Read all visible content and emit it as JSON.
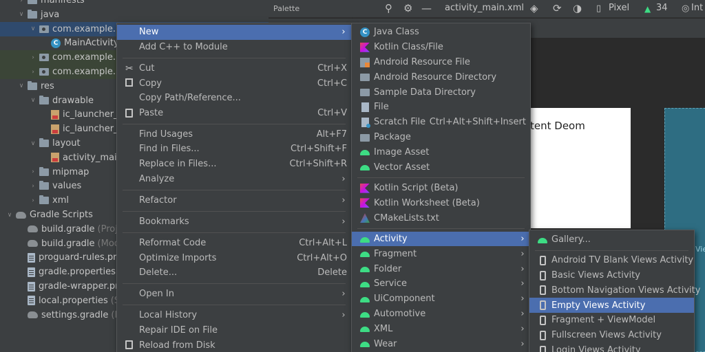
{
  "tree": {
    "rows": [
      {
        "label": "manifests",
        "hint": "",
        "indent": 1,
        "icon": "folder",
        "arrow": "right",
        "state": ""
      },
      {
        "label": "java",
        "hint": "",
        "indent": 1,
        "icon": "folder",
        "arrow": "down",
        "state": ""
      },
      {
        "label": "com.example.int",
        "hint": "",
        "indent": 2,
        "icon": "package",
        "arrow": "down",
        "state": "sel"
      },
      {
        "label": "MainActivity",
        "hint": "",
        "indent": 3,
        "icon": "class",
        "arrow": "none",
        "state": ""
      },
      {
        "label": "com.example.int",
        "hint": "",
        "indent": 2,
        "icon": "package",
        "arrow": "right",
        "state": "mod"
      },
      {
        "label": "com.example.int",
        "hint": "",
        "indent": 2,
        "icon": "package",
        "arrow": "right",
        "state": "mod"
      },
      {
        "label": "res",
        "hint": "",
        "indent": 1,
        "icon": "folder",
        "arrow": "down",
        "state": ""
      },
      {
        "label": "drawable",
        "hint": "",
        "indent": 2,
        "icon": "folder",
        "arrow": "down",
        "state": ""
      },
      {
        "label": "ic_launcher_b",
        "hint": "",
        "indent": 3,
        "icon": "xml",
        "arrow": "none",
        "state": ""
      },
      {
        "label": "ic_launcher_f",
        "hint": "",
        "indent": 3,
        "icon": "xml",
        "arrow": "none",
        "state": ""
      },
      {
        "label": "layout",
        "hint": "",
        "indent": 2,
        "icon": "folder",
        "arrow": "down",
        "state": ""
      },
      {
        "label": "activity_main",
        "hint": "",
        "indent": 3,
        "icon": "xml",
        "arrow": "none",
        "state": ""
      },
      {
        "label": "mipmap",
        "hint": "",
        "indent": 2,
        "icon": "folder",
        "arrow": "right",
        "state": ""
      },
      {
        "label": "values",
        "hint": "",
        "indent": 2,
        "icon": "folder",
        "arrow": "right",
        "state": ""
      },
      {
        "label": "xml",
        "hint": "",
        "indent": 2,
        "icon": "folder",
        "arrow": "right",
        "state": ""
      },
      {
        "label": "Gradle Scripts",
        "hint": "",
        "indent": 0,
        "icon": "gradle",
        "arrow": "down",
        "state": ""
      },
      {
        "label": "build.gradle",
        "hint": "(Proje",
        "indent": 1,
        "icon": "gradle",
        "arrow": "none",
        "state": ""
      },
      {
        "label": "build.gradle",
        "hint": "(Modu",
        "indent": 1,
        "icon": "gradle",
        "arrow": "none",
        "state": ""
      },
      {
        "label": "proguard-rules.pro",
        "hint": "",
        "indent": 1,
        "icon": "properties",
        "arrow": "none",
        "state": ""
      },
      {
        "label": "gradle.properties",
        "hint": "(P",
        "indent": 1,
        "icon": "properties",
        "arrow": "none",
        "state": ""
      },
      {
        "label": "gradle-wrapper.pro",
        "hint": "",
        "indent": 1,
        "icon": "properties",
        "arrow": "none",
        "state": ""
      },
      {
        "label": "local.properties",
        "hint": "(SD",
        "indent": 1,
        "icon": "properties",
        "arrow": "none",
        "state": ""
      },
      {
        "label": "settings.gradle",
        "hint": "(Pro",
        "indent": 1,
        "icon": "gradle",
        "arrow": "none",
        "state": ""
      }
    ]
  },
  "editor": {
    "palette_label": "Palette",
    "file_tab": "activity_main.xml",
    "device": "Pixel",
    "api_level": "34",
    "locale": "Int",
    "preview_text": "tent Deom",
    "blueprint_text": "Vie"
  },
  "context_menu": {
    "items": [
      {
        "label": "New",
        "shortcut": "",
        "submenu": true,
        "icon": "",
        "sep_after": false,
        "highlighted": true
      },
      {
        "label": "Add C++ to Module",
        "shortcut": "",
        "submenu": false,
        "icon": "",
        "sep_after": true
      },
      {
        "label": "Cut",
        "shortcut": "Ctrl+X",
        "submenu": false,
        "icon": "cut-icon",
        "sep_after": false
      },
      {
        "label": "Copy",
        "shortcut": "Ctrl+C",
        "submenu": false,
        "icon": "copy-icon",
        "sep_after": false
      },
      {
        "label": "Copy Path/Reference...",
        "shortcut": "",
        "submenu": false,
        "icon": "",
        "sep_after": false
      },
      {
        "label": "Paste",
        "shortcut": "Ctrl+V",
        "submenu": false,
        "icon": "paste-icon",
        "sep_after": true
      },
      {
        "label": "Find Usages",
        "shortcut": "Alt+F7",
        "submenu": false,
        "icon": "",
        "sep_after": false
      },
      {
        "label": "Find in Files...",
        "shortcut": "Ctrl+Shift+F",
        "submenu": false,
        "icon": "",
        "sep_after": false
      },
      {
        "label": "Replace in Files...",
        "shortcut": "Ctrl+Shift+R",
        "submenu": false,
        "icon": "",
        "sep_after": false
      },
      {
        "label": "Analyze",
        "shortcut": "",
        "submenu": true,
        "icon": "",
        "sep_after": true
      },
      {
        "label": "Refactor",
        "shortcut": "",
        "submenu": true,
        "icon": "",
        "sep_after": true
      },
      {
        "label": "Bookmarks",
        "shortcut": "",
        "submenu": true,
        "icon": "",
        "sep_after": true
      },
      {
        "label": "Reformat Code",
        "shortcut": "Ctrl+Alt+L",
        "submenu": false,
        "icon": "",
        "sep_after": false
      },
      {
        "label": "Optimize Imports",
        "shortcut": "Ctrl+Alt+O",
        "submenu": false,
        "icon": "",
        "sep_after": false
      },
      {
        "label": "Delete...",
        "shortcut": "Delete",
        "submenu": false,
        "icon": "",
        "sep_after": true
      },
      {
        "label": "Open In",
        "shortcut": "",
        "submenu": true,
        "icon": "",
        "sep_after": true
      },
      {
        "label": "Local History",
        "shortcut": "",
        "submenu": true,
        "icon": "",
        "sep_after": false
      },
      {
        "label": "Repair IDE on File",
        "shortcut": "",
        "submenu": false,
        "icon": "",
        "sep_after": false
      },
      {
        "label": "Reload from Disk",
        "shortcut": "",
        "submenu": false,
        "icon": "reload-icon",
        "sep_after": false
      }
    ]
  },
  "new_menu": {
    "items": [
      {
        "label": "Java Class",
        "shortcut": "",
        "submenu": false,
        "icon": "java-class-icon",
        "sep_after": false
      },
      {
        "label": "Kotlin Class/File",
        "shortcut": "",
        "submenu": false,
        "icon": "kotlin-icon",
        "sep_after": false
      },
      {
        "label": "Android Resource File",
        "shortcut": "",
        "submenu": false,
        "icon": "resource-file-icon",
        "sep_after": false
      },
      {
        "label": "Android Resource Directory",
        "shortcut": "",
        "submenu": false,
        "icon": "folder-icon",
        "sep_after": false
      },
      {
        "label": "Sample Data Directory",
        "shortcut": "",
        "submenu": false,
        "icon": "folder-icon",
        "sep_after": false
      },
      {
        "label": "File",
        "shortcut": "",
        "submenu": false,
        "icon": "file-icon",
        "sep_after": false
      },
      {
        "label": "Scratch File",
        "shortcut": "Ctrl+Alt+Shift+Insert",
        "submenu": false,
        "icon": "scratch-file-icon",
        "sep_after": false
      },
      {
        "label": "Package",
        "shortcut": "",
        "submenu": false,
        "icon": "package-icon",
        "sep_after": false
      },
      {
        "label": "Image Asset",
        "shortcut": "",
        "submenu": false,
        "icon": "android-icon",
        "sep_after": false
      },
      {
        "label": "Vector Asset",
        "shortcut": "",
        "submenu": false,
        "icon": "android-icon",
        "sep_after": true
      },
      {
        "label": "Kotlin Script (Beta)",
        "shortcut": "",
        "submenu": false,
        "icon": "kotlin-icon",
        "sep_after": false
      },
      {
        "label": "Kotlin Worksheet (Beta)",
        "shortcut": "",
        "submenu": false,
        "icon": "kotlin-icon",
        "sep_after": false
      },
      {
        "label": "CMakeLists.txt",
        "shortcut": "",
        "submenu": false,
        "icon": "cmake-icon",
        "sep_after": true
      },
      {
        "label": "Activity",
        "shortcut": "",
        "submenu": true,
        "icon": "android-icon",
        "sep_after": false,
        "highlighted": true
      },
      {
        "label": "Fragment",
        "shortcut": "",
        "submenu": true,
        "icon": "android-icon",
        "sep_after": false
      },
      {
        "label": "Folder",
        "shortcut": "",
        "submenu": true,
        "icon": "android-icon",
        "sep_after": false
      },
      {
        "label": "Service",
        "shortcut": "",
        "submenu": true,
        "icon": "android-icon",
        "sep_after": false
      },
      {
        "label": "UiComponent",
        "shortcut": "",
        "submenu": true,
        "icon": "android-icon",
        "sep_after": false
      },
      {
        "label": "Automotive",
        "shortcut": "",
        "submenu": true,
        "icon": "android-icon",
        "sep_after": false
      },
      {
        "label": "XML",
        "shortcut": "",
        "submenu": true,
        "icon": "android-icon",
        "sep_after": false
      },
      {
        "label": "Wear",
        "shortcut": "",
        "submenu": true,
        "icon": "android-icon",
        "sep_after": false
      }
    ]
  },
  "activity_menu": {
    "items": [
      {
        "label": "Gallery...",
        "icon": "android-icon",
        "sep_after": true
      },
      {
        "label": "Android TV Blank Views Activity",
        "icon": "device-icon",
        "sep_after": false
      },
      {
        "label": "Basic Views Activity",
        "icon": "device-icon",
        "sep_after": false
      },
      {
        "label": "Bottom Navigation Views Activity",
        "icon": "device-icon",
        "sep_after": false
      },
      {
        "label": "Empty Views Activity",
        "icon": "device-icon",
        "sep_after": false,
        "highlighted": true
      },
      {
        "label": "Fragment + ViewModel",
        "icon": "device-icon",
        "sep_after": false
      },
      {
        "label": "Fullscreen Views Activity",
        "icon": "device-icon",
        "sep_after": false
      },
      {
        "label": "Login Views Activity",
        "icon": "device-icon",
        "sep_after": false
      }
    ]
  },
  "colors": {
    "highlight": "#4b6eaf",
    "menu_bg": "#3c3f41",
    "android_green": "#3ddc84"
  }
}
